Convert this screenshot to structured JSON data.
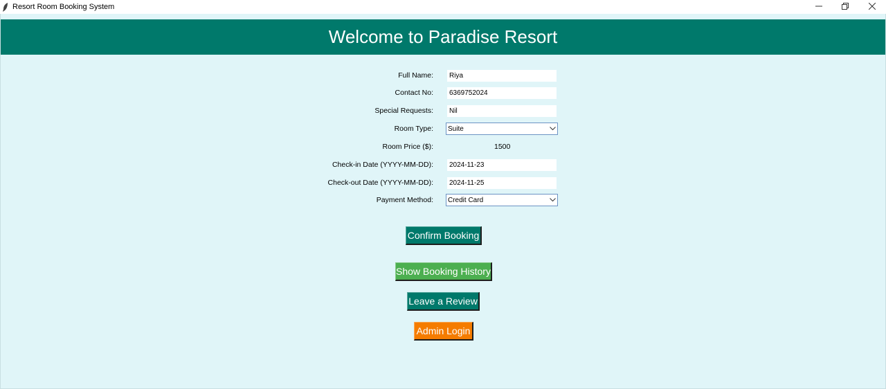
{
  "window": {
    "title": "Resort Room Booking System"
  },
  "header": {
    "title": "Welcome to Paradise Resort"
  },
  "form": {
    "full_name": {
      "label": "Full Name:",
      "value": "Riya"
    },
    "contact_no": {
      "label": "Contact No:",
      "value": "6369752024"
    },
    "special_requests": {
      "label": "Special Requests:",
      "value": "Nil"
    },
    "room_type": {
      "label": "Room Type:",
      "value": "Suite"
    },
    "room_price": {
      "label": "Room Price ($):",
      "value": "1500"
    },
    "check_in": {
      "label": "Check-in Date (YYYY-MM-DD):",
      "value": "2024-11-23"
    },
    "check_out": {
      "label": "Check-out Date (YYYY-MM-DD):",
      "value": "2024-11-25"
    },
    "payment_method": {
      "label": "Payment Method:",
      "value": "Credit Card"
    }
  },
  "buttons": {
    "confirm": "Confirm Booking",
    "history": "Show Booking History",
    "review": "Leave a Review",
    "admin": "Admin Login"
  },
  "colors": {
    "header_bg": "#00796b",
    "client_bg": "#e0f5f8",
    "confirm_bg": "#00796b",
    "history_bg": "#4caf50",
    "review_bg": "#00796b",
    "admin_bg": "#f57c00"
  },
  "icons": {
    "app": "feather-icon",
    "minimize": "minimize-icon",
    "maximize": "restore-icon",
    "close": "close-icon",
    "dropdown": "chevron-down-icon"
  }
}
